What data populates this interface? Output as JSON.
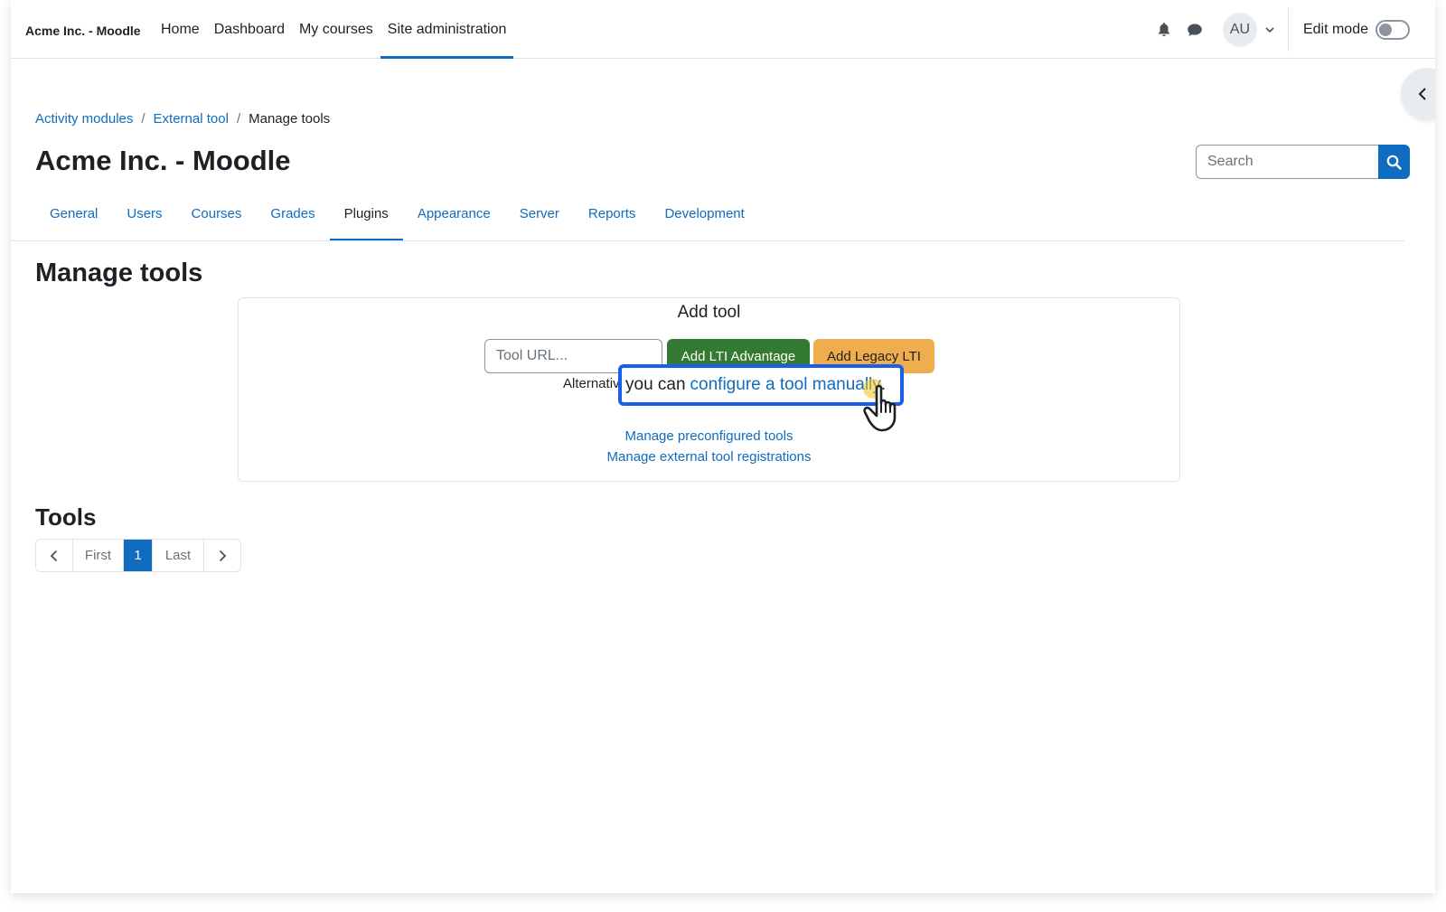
{
  "navbar": {
    "brand": "Acme Inc. - Moodle",
    "items": [
      {
        "label": "Home",
        "active": false
      },
      {
        "label": "Dashboard",
        "active": false
      },
      {
        "label": "My courses",
        "active": false
      },
      {
        "label": "Site administration",
        "active": true
      }
    ],
    "avatar_initials": "AU",
    "edit_mode_label": "Edit mode",
    "edit_mode_on": false
  },
  "breadcrumb": {
    "items": [
      "Activity modules",
      "External tool"
    ],
    "current": "Manage tools",
    "separator": "/"
  },
  "header": {
    "title": "Acme Inc. - Moodle",
    "search_placeholder": "Search"
  },
  "secondary_nav": {
    "tabs": [
      {
        "label": "General",
        "active": false
      },
      {
        "label": "Users",
        "active": false
      },
      {
        "label": "Courses",
        "active": false
      },
      {
        "label": "Grades",
        "active": false
      },
      {
        "label": "Plugins",
        "active": true
      },
      {
        "label": "Appearance",
        "active": false
      },
      {
        "label": "Server",
        "active": false
      },
      {
        "label": "Reports",
        "active": false
      },
      {
        "label": "Development",
        "active": false
      }
    ]
  },
  "main": {
    "heading": "Manage tools",
    "add_tool": {
      "title": "Add tool",
      "url_placeholder": "Tool URL...",
      "btn_lti_advantage": "Add LTI Advantage",
      "btn_legacy_lti": "Add Legacy LTI",
      "alt_prefix": "Alternativ",
      "callout_text": "you can",
      "callout_link": "configure a tool manually",
      "callout_end": ".",
      "link_preconfigured": "Manage preconfigured tools",
      "link_registrations": "Manage external tool registrations"
    },
    "tools_heading": "Tools",
    "pagination": {
      "first": "First",
      "current": "1",
      "last": "Last"
    }
  },
  "icons": {
    "notifications": "bell-icon",
    "messages": "chat-bubble-icon",
    "user_menu": "chevron-down-icon",
    "drawer": "chevron-left-icon",
    "search": "search-icon",
    "cursor": "hand-pointer-icon"
  },
  "colors": {
    "primary": "#0f6cbf",
    "success": "#357a32",
    "warning": "#f0ad4e",
    "callout_border": "#1a5fe8",
    "cursor_glow": "#f5c518"
  }
}
